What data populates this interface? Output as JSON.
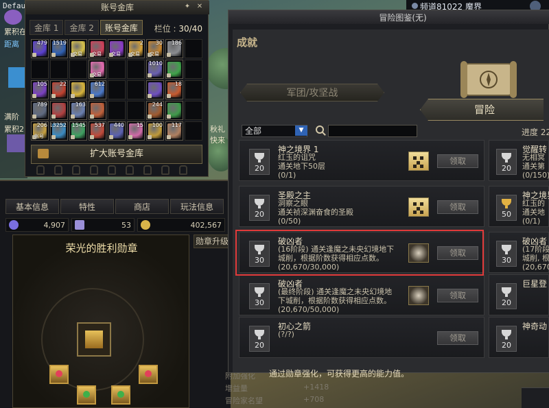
{
  "hud": {
    "default_tag": "Default",
    "left_texts": [
      "累积在",
      "距离",
      "满阶",
      "累积2"
    ],
    "event_texts": [
      "秋礼",
      "快来"
    ]
  },
  "vault": {
    "title": "账号金库",
    "tabs": [
      {
        "label": "金库 1",
        "active": false
      },
      {
        "label": "金库 2",
        "active": false
      },
      {
        "label": "账号金库",
        "active": true
      }
    ],
    "slots_label": "栏位 : ",
    "slots_value": "30/40",
    "expand_button": "扩大账号金库",
    "items": [
      {
        "qty": "479",
        "trade": "",
        "color": "#5a3fd0"
      },
      {
        "qty": "1519",
        "trade": "",
        "color": "#2f5fb0"
      },
      {
        "qty": "",
        "trade": "交易",
        "color": "#d8c24a"
      },
      {
        "qty": "",
        "trade": "交易",
        "color": "#d0405a"
      },
      {
        "qty": "",
        "trade": "交易",
        "color": "#8a3bc7"
      },
      {
        "qty": "2",
        "trade": "交易",
        "color": "#d9a43a"
      },
      {
        "qty": "30",
        "trade": "交易",
        "color": "#c7852f"
      },
      {
        "qty": "186",
        "trade": "",
        "color": "#8b8d91"
      },
      {
        "qty": "",
        "trade": "",
        "color": ""
      },
      {
        "qty": "",
        "trade": "",
        "color": ""
      },
      {
        "qty": "",
        "trade": "",
        "color": ""
      },
      {
        "qty": "",
        "trade": "",
        "color": ""
      },
      {
        "qty": "",
        "trade": "交易",
        "color": "#e56bb0"
      },
      {
        "qty": "",
        "trade": "",
        "color": ""
      },
      {
        "qty": "",
        "trade": "",
        "color": ""
      },
      {
        "qty": "1010",
        "trade": "",
        "color": "#6a5fb0"
      },
      {
        "qty": "",
        "trade": "",
        "color": "#3fa34a"
      },
      {
        "qty": "",
        "trade": "",
        "color": ""
      },
      {
        "qty": "105",
        "trade": "",
        "color": "#7a40c0"
      },
      {
        "qty": "22",
        "trade": "",
        "color": "#c0412f"
      },
      {
        "qty": "",
        "trade": "",
        "color": "#d8b43a"
      },
      {
        "qty": "612",
        "trade": "",
        "color": "#4a78c8"
      },
      {
        "qty": "",
        "trade": "",
        "color": ""
      },
      {
        "qty": "",
        "trade": "",
        "color": ""
      },
      {
        "qty": "",
        "trade": "",
        "color": "#6f4fc0"
      },
      {
        "qty": "18",
        "trade": "",
        "color": "#c75a2f"
      },
      {
        "qty": "",
        "trade": "",
        "color": ""
      },
      {
        "qty": "789",
        "trade": "",
        "color": "#5f6a80"
      },
      {
        "qty": "",
        "trade": "",
        "color": "#b04040"
      },
      {
        "qty": "163",
        "trade": "",
        "color": "#6a7fb0"
      },
      {
        "qty": "",
        "trade": "",
        "color": "#c0603a"
      },
      {
        "qty": "",
        "trade": "",
        "color": ""
      },
      {
        "qty": "",
        "trade": "",
        "color": ""
      },
      {
        "qty": "244",
        "trade": "",
        "color": "#a05a2f"
      },
      {
        "qty": "",
        "trade": "",
        "color": "#3f9a4a"
      },
      {
        "qty": "",
        "trade": "",
        "color": ""
      },
      {
        "qty": "206",
        "trade": "账号",
        "color": "#c7a040"
      },
      {
        "qty": "13252",
        "trade": "",
        "color": "#3a8ac0"
      },
      {
        "qty": "1545",
        "trade": "",
        "color": "#3fa060"
      },
      {
        "qty": "537",
        "trade": "",
        "color": "#c04a3a"
      },
      {
        "qty": "440",
        "trade": "",
        "color": "#5a60b0"
      },
      {
        "qty": "15",
        "trade": "",
        "color": "#d06aa8"
      },
      {
        "qty": "100",
        "trade": "",
        "color": "#c09a3a"
      },
      {
        "qty": "117",
        "trade": "",
        "color": "#b08060"
      },
      {
        "qty": "",
        "trade": "",
        "color": ""
      }
    ]
  },
  "character": {
    "tabs": [
      "基本信息",
      "特性",
      "商店",
      "玩法信息"
    ],
    "currencies": [
      {
        "value": "4,907",
        "color": "#7a6fe0"
      },
      {
        "value": "53",
        "color": "#9a8fd8"
      },
      {
        "value": "402,567",
        "color": "#d8b44a"
      }
    ],
    "medal_title": "荣光的胜利勋章",
    "medal_subtab": "勋章升级",
    "stats": [
      "附加强化",
      "增益量",
      "冒险家名望"
    ],
    "stat_values": [
      "+1418",
      "+708"
    ]
  },
  "topbar": {
    "channel": "频道81022 魔界"
  },
  "adventure": {
    "title": "冒险图鉴(无)",
    "header": "成就",
    "tab_military": "军团/攻坚战",
    "tab_adventure": "冒险",
    "filter_value": "全部",
    "search_placeholder": "",
    "progress": "进度 22",
    "cards": [
      {
        "points": "20",
        "title": "神之境界 1",
        "desc1": "红玉的诅咒",
        "desc2": "通关地下50层",
        "progress": "(0/1)",
        "reward": "tile",
        "claim": "领取",
        "gold": false
      },
      {
        "points": "20",
        "title": "圣殿之主",
        "desc1": "洞察之眼",
        "desc2": "通关祯深渊奋食的圣殿",
        "progress": "(0/50)",
        "reward": "tile",
        "claim": "领取",
        "gold": false
      },
      {
        "points": "30",
        "title": "破凶者",
        "desc1": "(16阶段) 通关逢魔之未央幻境地下",
        "desc2": "城削，根据阶数获得相应点数。",
        "progress": "(20,670/30,000)",
        "reward": "emblem",
        "claim": "领取",
        "gold": false
      },
      {
        "points": "30",
        "title": "破凶者",
        "desc1": "(最终阶段) 通关逢魔之未央幻境地",
        "desc2": "下城削，根据阶数获得相应点数。",
        "progress": "(20,670/50,000)",
        "reward": "emblem",
        "claim": "领取",
        "gold": false
      },
      {
        "points": "20",
        "title": "初心之箭",
        "desc1": "",
        "desc2": "(?/?)",
        "progress": "",
        "reward": "none",
        "claim": "领取",
        "gold": false
      }
    ],
    "right_cards": [
      {
        "points": "20",
        "title": "觉醒转",
        "desc1": "无相冥",
        "desc2": "通关第",
        "progress": "(0/150)",
        "gold": false
      },
      {
        "points": "50",
        "title": "神之境界",
        "desc1": "红玉的",
        "desc2": "通关地",
        "progress": "(0/1)",
        "gold": true
      },
      {
        "points": "30",
        "title": "破凶者",
        "desc1": "(17阶段)",
        "desc2": "城削, 根",
        "progress": "(20,670",
        "gold": false
      },
      {
        "points": "20",
        "title": "巨星登",
        "desc1": "",
        "desc2": "",
        "progress": "",
        "gold": false
      },
      {
        "points": "20",
        "title": "神奇动",
        "desc1": "",
        "desc2": "",
        "progress": "",
        "gold": false
      }
    ],
    "bottom_text": "通过勋章强化，可获得更高的能力值。"
  }
}
